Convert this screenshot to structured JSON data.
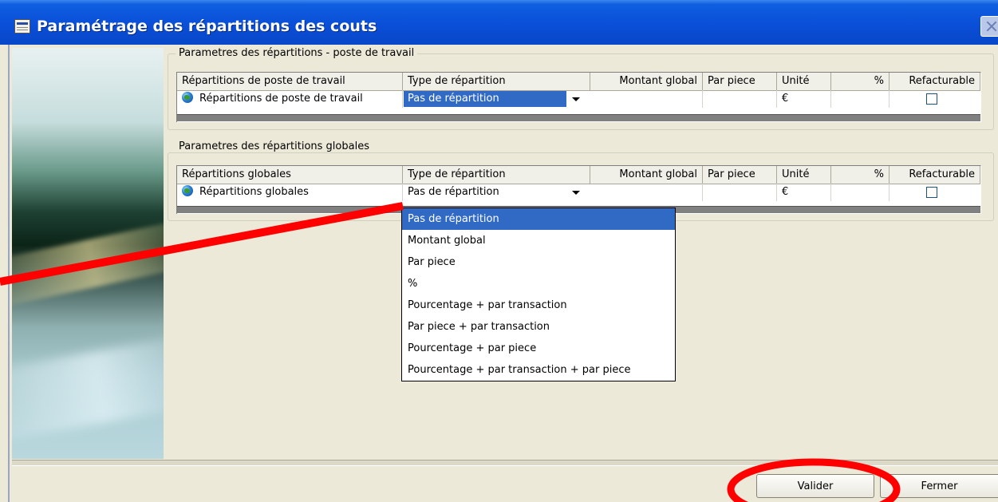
{
  "window": {
    "title": "Paramétrage des répartitions des couts"
  },
  "group_poste": {
    "legend": "Parametres des répartitions - poste de travail",
    "columns": [
      "Répartitions de poste de travail",
      "Type de répartition",
      "Montant global",
      "Par piece",
      "Unité",
      "%",
      "Refacturable"
    ],
    "row": {
      "name": "Répartitions de poste de travail",
      "type": "Pas de répartition",
      "montant": "",
      "par_piece": "",
      "unite": "€",
      "pct": "",
      "refacturable": false
    }
  },
  "group_global": {
    "legend": "Parametres des répartitions globales",
    "columns": [
      "Répartitions globales",
      "Type de répartition",
      "Montant global",
      "Par piece",
      "Unité",
      "%",
      "Refacturable"
    ],
    "row": {
      "name": "Répartitions globales",
      "type": "Pas de répartition",
      "montant": "",
      "par_piece": "",
      "unite": "€",
      "pct": "",
      "refacturable": false
    }
  },
  "dropdown": {
    "options": [
      "Pas de répartition",
      "Montant global",
      "Par piece",
      "%",
      "Pourcentage + par transaction",
      "Par piece + par transaction",
      "Pourcentage + par piece",
      "Pourcentage + par transaction + par piece"
    ],
    "highlighted": "Pas de répartition"
  },
  "buttons": {
    "validate": "Valider",
    "close": "Fermer"
  },
  "colors": {
    "annotation": "#ff0000",
    "selection": "#316ac5",
    "titlebar": "#0a4fd8"
  }
}
